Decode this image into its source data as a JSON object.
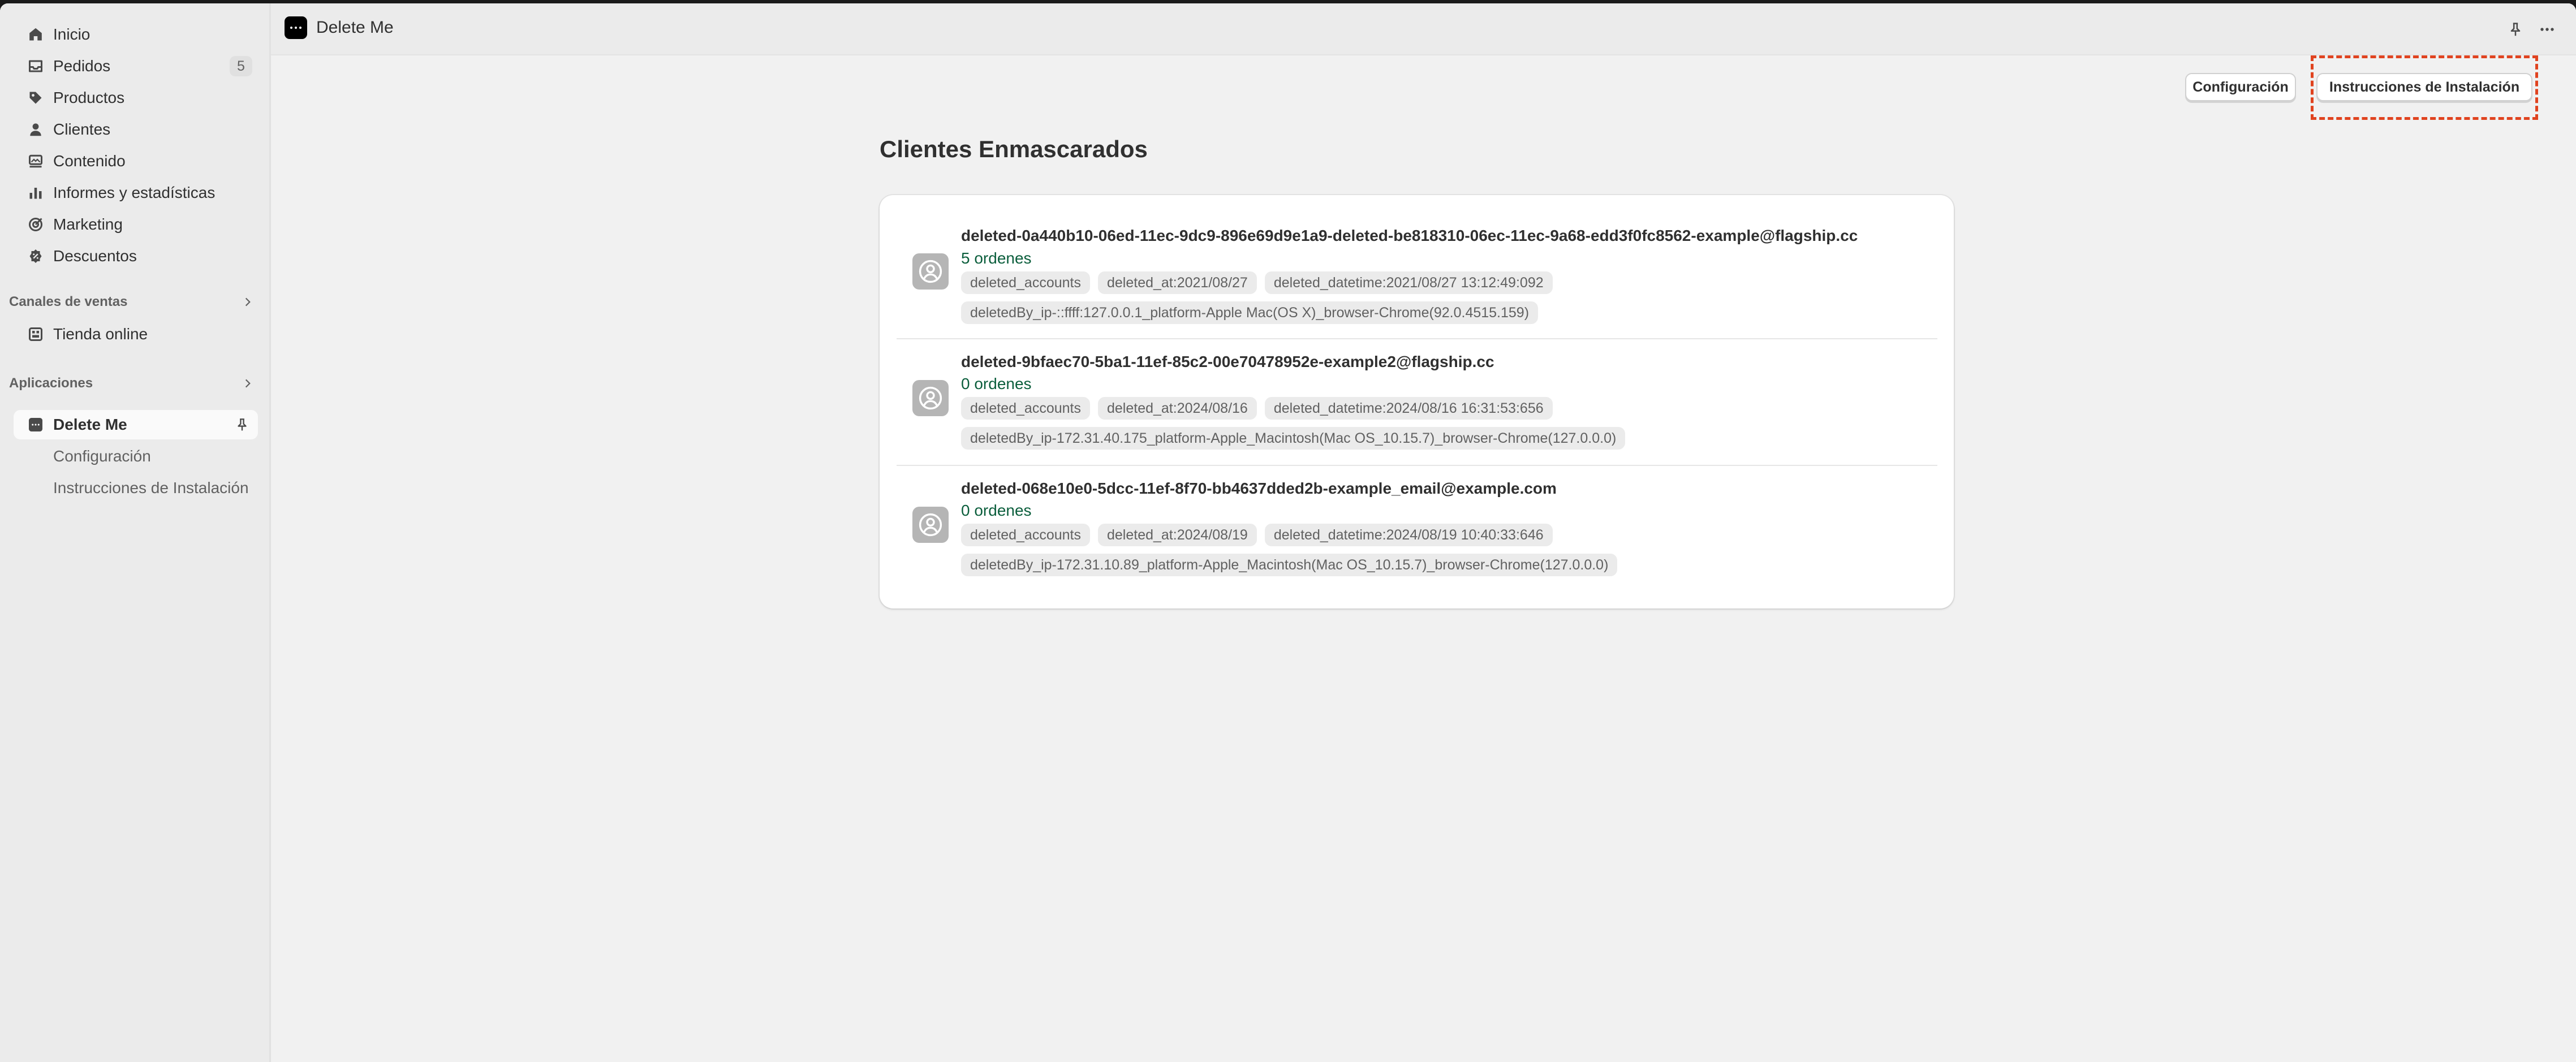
{
  "sidebar": {
    "nav": [
      {
        "label": "Inicio",
        "icon": "home-icon"
      },
      {
        "label": "Pedidos",
        "icon": "inbox-icon",
        "badge": "5"
      },
      {
        "label": "Productos",
        "icon": "tag-icon"
      },
      {
        "label": "Clientes",
        "icon": "person-icon"
      },
      {
        "label": "Contenido",
        "icon": "content-icon"
      },
      {
        "label": "Informes y estadísticas",
        "icon": "chart-icon"
      },
      {
        "label": "Marketing",
        "icon": "target-icon"
      },
      {
        "label": "Descuentos",
        "icon": "discount-icon"
      }
    ],
    "sales_channels": {
      "heading": "Canales de ventas",
      "items": [
        {
          "label": "Tienda online",
          "icon": "store-icon"
        }
      ]
    },
    "apps": {
      "heading": "Aplicaciones",
      "active_app": {
        "label": "Delete Me",
        "icon": "app-dots-icon"
      },
      "sub_items": [
        {
          "label": "Configuración"
        },
        {
          "label": "Instrucciones de Instalación"
        }
      ]
    }
  },
  "topbar": {
    "app_title": "Delete Me",
    "icons": [
      "pin-icon",
      "more-horizontal-icon"
    ]
  },
  "actions": {
    "config_label": "Configuración",
    "install_label": "Instrucciones de Instalación"
  },
  "page": {
    "title": "Clientes Enmascarados"
  },
  "customers": [
    {
      "email": "deleted-0a440b10-06ed-11ec-9dc9-896e69d9e1a9-deleted-be818310-06ec-11ec-9a68-edd3f0fc8562-example@flagship.cc",
      "orders": "5 ordenes",
      "tags_line1": [
        "deleted_accounts",
        "deleted_at:2021/08/27",
        "deleted_datetime:2021/08/27 13:12:49:092"
      ],
      "tags_line2": [
        "deletedBy_ip-::ffff:127.0.0.1_platform-Apple Mac(OS X)_browser-Chrome(92.0.4515.159)"
      ]
    },
    {
      "email": "deleted-9bfaec70-5ba1-11ef-85c2-00e70478952e-example2@flagship.cc",
      "orders": "0 ordenes",
      "tags_line1": [
        "deleted_accounts",
        "deleted_at:2024/08/16",
        "deleted_datetime:2024/08/16 16:31:53:656"
      ],
      "tags_line2": [
        "deletedBy_ip-172.31.40.175_platform-Apple_Macintosh(Mac OS_10.15.7)_browser-Chrome(127.0.0.0)"
      ]
    },
    {
      "email": "deleted-068e10e0-5dcc-11ef-8f70-bb4637dded2b-example_email@example.com",
      "orders": "0 ordenes",
      "tags_line1": [
        "deleted_accounts",
        "deleted_at:2024/08/19",
        "deleted_datetime:2024/08/19 10:40:33:646"
      ],
      "tags_line2": [
        "deletedBy_ip-172.31.10.89_platform-Apple_Macintosh(Mac OS_10.15.7)_browser-Chrome(127.0.0.0)"
      ]
    }
  ],
  "colors": {
    "accent_highlight": "#e0431f",
    "orders_text": "#0b5e3c"
  }
}
